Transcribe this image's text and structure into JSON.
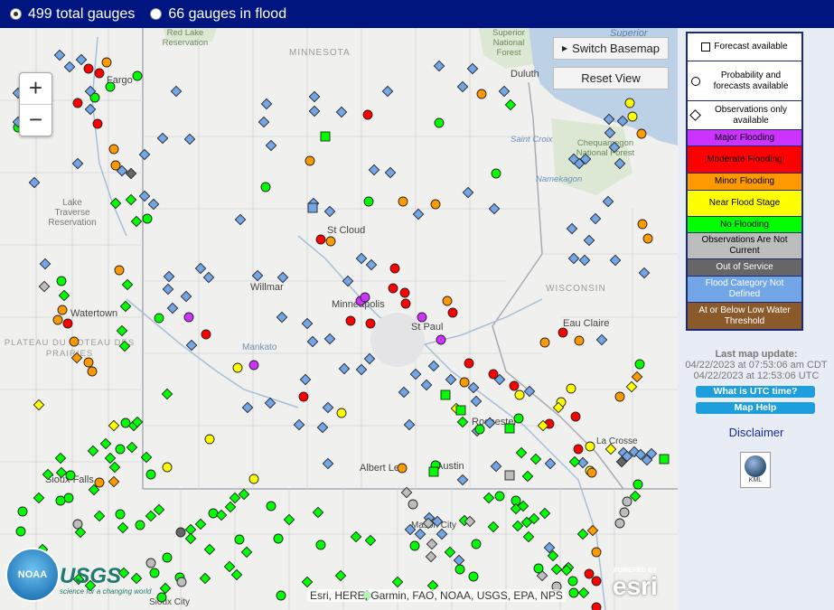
{
  "topbar": {
    "total_label": "499 total gauges",
    "flood_label": "66 gauges in flood"
  },
  "map_buttons": {
    "basemap": "Switch Basemap",
    "reset": "Reset View"
  },
  "zoom": {
    "in": "+",
    "out": "−"
  },
  "legend": {
    "forecast": "Forecast available",
    "probability": "Probability and forecasts available",
    "observations": "Observations only available",
    "major": "Major Flooding",
    "moderate": "Moderate Flooding",
    "minor": "Minor Flooding",
    "near": "Near Flood Stage",
    "none": "No Flooding",
    "not_current": "Observations Are Not Current",
    "out_of_service": "Out of Service",
    "not_defined": "Flood Category Not Defined",
    "low": "At or Below Low Water Threshold"
  },
  "info": {
    "title": "Last map update:",
    "cdt": "04/22/2023 at 07:53:06 am CDT",
    "utc": "04/22/2023 at 12:53:06 UTC"
  },
  "buttons": {
    "utc": "What is UTC time?",
    "help": "Map Help"
  },
  "disclaimer": "Disclaimer",
  "kml": "KML",
  "attribution": "Esri, HERE, Garmin, FAO, NOAA, USGS, EPA, NPS",
  "esri": "esri",
  "esri_powered": "POWERED BY",
  "usgs": "USGS",
  "usgs_tag": "science for a changing world",
  "noaa": "NOAA",
  "places": [
    "MINNESOTA",
    "WISCONSIN",
    "St Cloud",
    "Minneapolis",
    "St Paul",
    "Willmar",
    "Duluth",
    "Eau Claire",
    "Albert Lea",
    "Austin",
    "Rochester",
    "Sioux Falls",
    "Watertown",
    "Fargo",
    "Lake Traverse Reservation",
    "Superior",
    "Mankato",
    "Chequamegon National Forest",
    "Superior National Forest",
    "Red Lake Reservation",
    "PLATEAU DU COTEAU DES PRAIRIES",
    "La Crosse",
    "Mason City",
    "Sioux City",
    "Saint Croix",
    "Namekagon"
  ],
  "colors": {
    "major": "#cc33ff",
    "moderate": "#ff0000",
    "minor": "#ff9900",
    "near": "#ffff00",
    "none": "#00ff00",
    "not_current": "#bdbdbd",
    "out_of_service": "#666666",
    "not_defined": "#72a6e6",
    "low": "#8b5a2b",
    "header": "#00157f",
    "legend_border": "#1a2a7a",
    "button": "#1d9fde"
  }
}
